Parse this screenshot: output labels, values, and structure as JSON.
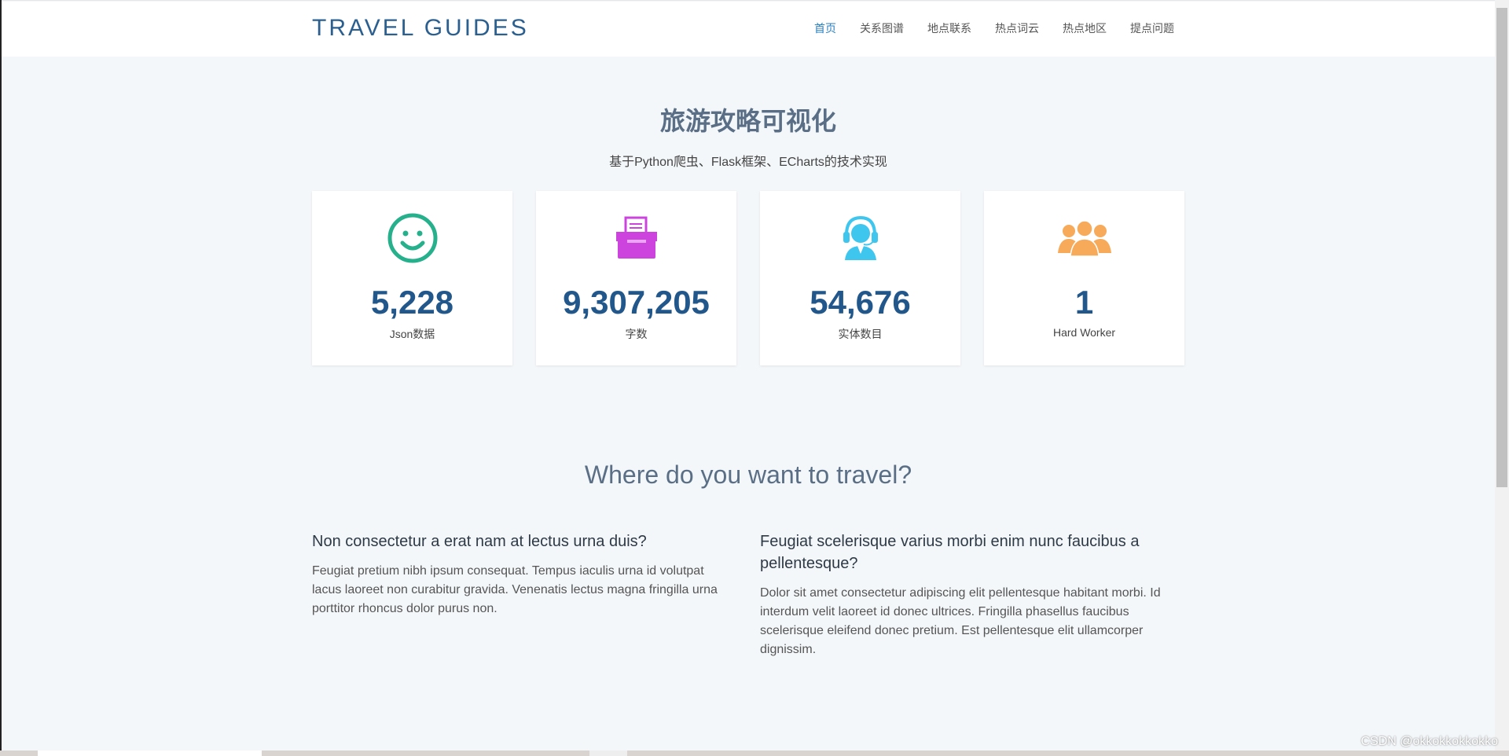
{
  "header": {
    "brand": "TRAVEL GUIDES",
    "nav": [
      "首页",
      "关系图谱",
      "地点联系",
      "热点词云",
      "热点地区",
      "提点问题"
    ],
    "active_index": 0
  },
  "hero": {
    "title": "旅游攻略可视化",
    "subtitle": "基于Python爬虫、Flask框架、ECharts的技术实现"
  },
  "stats": [
    {
      "icon": "smile-icon",
      "color": "#26b08c",
      "value": "5,228",
      "label": "Json数据"
    },
    {
      "icon": "printer-icon",
      "color": "#cc44dd",
      "value": "9,307,205",
      "label": "字数"
    },
    {
      "icon": "headset-person-icon",
      "color": "#3ec6ef",
      "value": "54,676",
      "label": "实体数目"
    },
    {
      "icon": "group-icon",
      "color": "#f6aa5a",
      "value": "1",
      "label": "Hard Worker"
    }
  ],
  "section": {
    "title": "Where do you want to travel?",
    "left": {
      "heading": "Non consectetur a erat nam at lectus urna duis?",
      "body": "Feugiat pretium nibh ipsum consequat. Tempus iaculis urna id volutpat lacus laoreet non curabitur gravida. Venenatis lectus magna fringilla urna porttitor rhoncus dolor purus non."
    },
    "right": {
      "heading": "Feugiat scelerisque varius morbi enim nunc faucibus a pellentesque?",
      "body": "Dolor sit amet consectetur adipiscing elit pellentesque habitant morbi. Id interdum velit laoreet id donec ultrices. Fringilla phasellus faucibus scelerisque eleifend donec pretium. Est pellentesque elit ullamcorper dignissim."
    }
  },
  "watermark": "CSDN @okkokkokkokko"
}
